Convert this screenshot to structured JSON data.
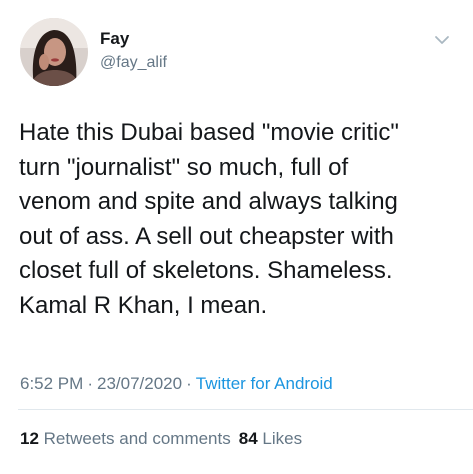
{
  "author": {
    "display_name": "Fay",
    "handle": "@fay_alif"
  },
  "tweet": {
    "text_lines": [
      "Hate this Dubai based \"movie critic\"",
      "turn \"journalist\" so much, full of",
      "venom and spite and always talking",
      "out of ass. A sell out cheapster with",
      "closet full of skeletons. Shameless.",
      "Kamal R Khan, I mean."
    ],
    "time": "6:52 PM",
    "date": "23/07/2020",
    "separator": "·",
    "source": "Twitter for Android"
  },
  "stats": {
    "retweets_count": "12",
    "retweets_label": "Retweets and comments",
    "likes_count": "84",
    "likes_label": "Likes"
  },
  "icons": {
    "menu": "chevron-down-icon",
    "avatar": "profile-photo"
  },
  "colors": {
    "text": "#14171a",
    "secondary": "#657786",
    "link": "#1b95e0",
    "divider": "#e1e8ed"
  }
}
